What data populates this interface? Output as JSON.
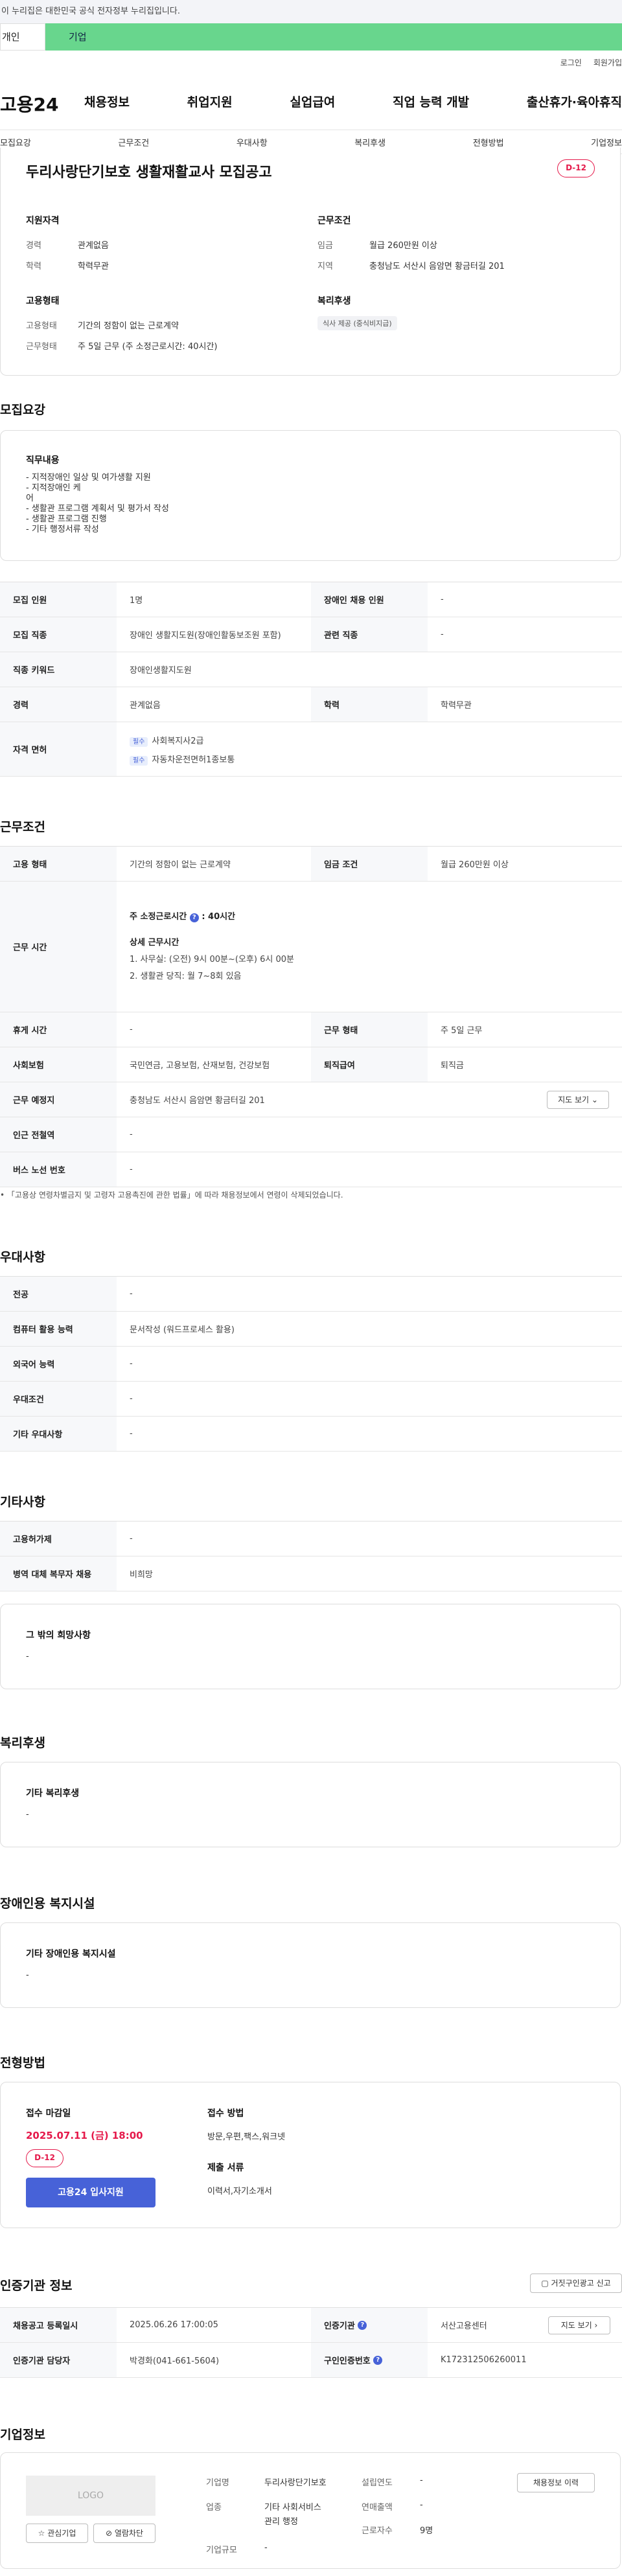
{
  "banner": {
    "text": "이 누리집은 대한민국 공식 전자정부 누리집입니다."
  },
  "tabs": {
    "personal": "개인",
    "company": "기업"
  },
  "util": {
    "login": "로그인",
    "join": "회원가입"
  },
  "logo": "고용24",
  "gnb": [
    "채용정보",
    "취업지원",
    "실업급여",
    "직업 능력 개발",
    "출산휴가·육아휴직"
  ],
  "anchors": [
    "모집요강",
    "근무조건",
    "우대사항",
    "복리후생",
    "전형방법",
    "기업정보"
  ],
  "summary": {
    "title": "두리사랑단기보호 생활재활교사 모집공고",
    "dday": "D-12",
    "qual_title": "지원자격",
    "career_k": "경력",
    "career_v": "관계없음",
    "edu_k": "학력",
    "edu_v": "학력무관",
    "cond_title": "근무조건",
    "wage_k": "임금",
    "wage_v": "월급 260만원 이상",
    "region_k": "지역",
    "region_v": "충청남도 서산시 음암면 황금터길 201",
    "emp_title": "고용형태",
    "emptype_k": "고용형태",
    "emptype_v": "기간의 정함이 없는 근로계약",
    "worktype_k": "근무형태",
    "worktype_v": "주 5일 근무 (주 소정근로시간: 40시간)",
    "welfare_title": "복리후생",
    "welfare_chip": "식사 제공 (중식비지급)"
  },
  "recruit": {
    "section": "모집요강",
    "duty_title": "직무내용",
    "duty_lines": [
      "- 지적장애인 일상 및 여가생활 지원",
      "- 지적장애인 케",
      "어",
      "- 생활관 프로그램 계획서 및 평가서 작성",
      "- 생활관 프로그램 진행",
      "- 기타 행정서류 작성"
    ],
    "headcount_k": "모집 인원",
    "headcount_v": "1명",
    "disabled_k": "장애인 채용 인원",
    "disabled_v": "-",
    "job_k": "모집 직종",
    "job_v": "장애인 생활지도원(장애인활동보조원 포함)",
    "related_k": "관련 직종",
    "related_v": "-",
    "keyword_k": "직종 키워드",
    "keyword_v": "장애인생활지도원",
    "career_k": "경력",
    "career_v": "관계없음",
    "edu_k": "학력",
    "edu_v": "학력무관",
    "license_k": "자격 면허",
    "license_tag": "필수",
    "license1": "사회복지사2급",
    "license2": "자동차운전면허1종보통"
  },
  "conditions": {
    "section": "근무조건",
    "emp_k": "고용 형태",
    "emp_v": "기간의 정함이 없는 근로계약",
    "wage_k": "임금 조건",
    "wage_v": "월급 260만원 이상",
    "time_k": "근무 시간",
    "time_hours": "주 소정근로시간",
    "time_hours_v": ": 40시간",
    "time_detail": "상세 근무시간",
    "time_line1": "1. 사무실: (오전) 9시 00분~(오후) 6시 00분",
    "time_line2": "2. 생활관 당직: 월 7~8회 있음",
    "holiday_k": "휴게 시간",
    "holiday_v": "-",
    "form_k": "근무 형태",
    "form_v": "주 5일 근무",
    "insure_k": "사회보험",
    "insure_v": "국민연금, 고용보험, 산재보험, 건강보험",
    "retire_k": "퇴직급여",
    "retire_v": "퇴직금",
    "place_k": "근무 예정지",
    "place_v": "충청남도 서산시 음암면 황금터길 201",
    "map_btn": "지도 보기",
    "subway_k": "인근 전철역",
    "subway_v": "-",
    "bus_k": "버스 노선 번호",
    "bus_v": "-",
    "note": "「고용상 연령차별금지 및 고령자 고용촉진에 관한 법률」에 따라 채용정보에서 연령이 삭제되었습니다."
  },
  "prefer": {
    "section": "우대사항",
    "major_k": "전공",
    "major_v": "-",
    "pc_k": "컴퓨터 활용 능력",
    "pc_v": "문서작성 (워드프로세스 활용)",
    "lang_k": "외국어 능력",
    "lang_v": "-",
    "cond_k": "우대조건",
    "cond_v": "-",
    "etc_k": "기타 우대사항",
    "etc_v": "-"
  },
  "others": {
    "section": "기타사항",
    "type_k": "고용허가제",
    "type_v": "-",
    "mil_k": "병역 대체 복무자 채용",
    "mil_v": "비희망",
    "wish_title": "그 밖의 희망사항",
    "wish_v": "-"
  },
  "welfare": {
    "section": "복리후생",
    "title": "기타 복리후생",
    "v": "-"
  },
  "facility": {
    "section": "장애인용 복지시설",
    "title": "기타 장애인용 복지시설",
    "v": "-"
  },
  "process": {
    "section": "전형방법",
    "deadline_title": "접수 마감일",
    "deadline": "2025.07.11 (금) 18:00",
    "dday": "D-12",
    "apply_btn": "고용24 입사지원",
    "method_title": "접수 방법",
    "method_v": "방문,우편,팩스,워크넷",
    "docs_title": "제출 서류",
    "docs_v": "이력서,자기소개서"
  },
  "auth": {
    "section": "인증기관 정보",
    "report_btn": "거짓구인광고 신고",
    "reg_k": "채용공고 등록일시",
    "reg_v": "2025.06.26 17:00:05",
    "org_k": "인증기관",
    "org_v": "서산고용센터",
    "map_btn": "지도 보기",
    "mgr_k": "인증기관 담당자",
    "mgr_v": "박경화(041-661-5604)",
    "no_k": "구인인증번호",
    "no_v": "K172312506260011"
  },
  "company": {
    "section": "기업정보",
    "logo_text": "LOGO",
    "fav_btn": "관심기업",
    "block_btn": "열람차단",
    "name_k": "기업명",
    "name_v": "두리사랑단기보호",
    "founded_k": "설립연도",
    "founded_v": "-",
    "industry_k": "업종",
    "industry_v1": "기타 사회서비스",
    "industry_v2": "관리 행정",
    "sales_k": "연매출액",
    "sales_v": "-",
    "staff_k": "근로자수",
    "staff_v": "9명",
    "scale_k": "기업규모",
    "scale_v": "-",
    "history_btn": "채용정보 이력"
  }
}
